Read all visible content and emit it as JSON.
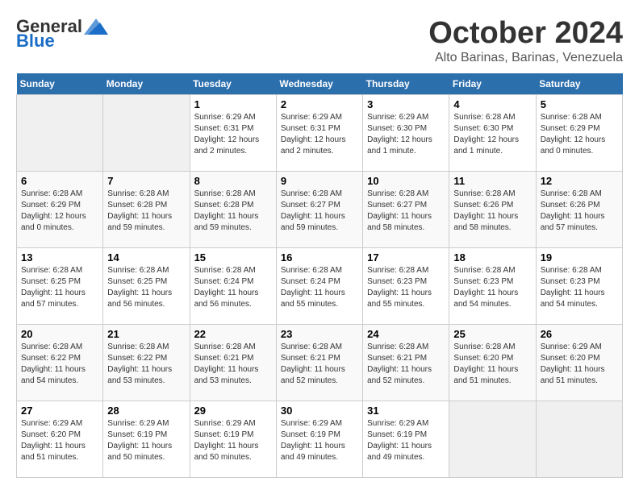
{
  "header": {
    "logo_general": "General",
    "logo_blue": "Blue",
    "month": "October 2024",
    "location": "Alto Barinas, Barinas, Venezuela"
  },
  "weekdays": [
    "Sunday",
    "Monday",
    "Tuesday",
    "Wednesday",
    "Thursday",
    "Friday",
    "Saturday"
  ],
  "weeks": [
    [
      {
        "day": "",
        "info": ""
      },
      {
        "day": "",
        "info": ""
      },
      {
        "day": "1",
        "info": "Sunrise: 6:29 AM\nSunset: 6:31 PM\nDaylight: 12 hours\nand 2 minutes."
      },
      {
        "day": "2",
        "info": "Sunrise: 6:29 AM\nSunset: 6:31 PM\nDaylight: 12 hours\nand 2 minutes."
      },
      {
        "day": "3",
        "info": "Sunrise: 6:29 AM\nSunset: 6:30 PM\nDaylight: 12 hours\nand 1 minute."
      },
      {
        "day": "4",
        "info": "Sunrise: 6:28 AM\nSunset: 6:30 PM\nDaylight: 12 hours\nand 1 minute."
      },
      {
        "day": "5",
        "info": "Sunrise: 6:28 AM\nSunset: 6:29 PM\nDaylight: 12 hours\nand 0 minutes."
      }
    ],
    [
      {
        "day": "6",
        "info": "Sunrise: 6:28 AM\nSunset: 6:29 PM\nDaylight: 12 hours\nand 0 minutes."
      },
      {
        "day": "7",
        "info": "Sunrise: 6:28 AM\nSunset: 6:28 PM\nDaylight: 11 hours\nand 59 minutes."
      },
      {
        "day": "8",
        "info": "Sunrise: 6:28 AM\nSunset: 6:28 PM\nDaylight: 11 hours\nand 59 minutes."
      },
      {
        "day": "9",
        "info": "Sunrise: 6:28 AM\nSunset: 6:27 PM\nDaylight: 11 hours\nand 59 minutes."
      },
      {
        "day": "10",
        "info": "Sunrise: 6:28 AM\nSunset: 6:27 PM\nDaylight: 11 hours\nand 58 minutes."
      },
      {
        "day": "11",
        "info": "Sunrise: 6:28 AM\nSunset: 6:26 PM\nDaylight: 11 hours\nand 58 minutes."
      },
      {
        "day": "12",
        "info": "Sunrise: 6:28 AM\nSunset: 6:26 PM\nDaylight: 11 hours\nand 57 minutes."
      }
    ],
    [
      {
        "day": "13",
        "info": "Sunrise: 6:28 AM\nSunset: 6:25 PM\nDaylight: 11 hours\nand 57 minutes."
      },
      {
        "day": "14",
        "info": "Sunrise: 6:28 AM\nSunset: 6:25 PM\nDaylight: 11 hours\nand 56 minutes."
      },
      {
        "day": "15",
        "info": "Sunrise: 6:28 AM\nSunset: 6:24 PM\nDaylight: 11 hours\nand 56 minutes."
      },
      {
        "day": "16",
        "info": "Sunrise: 6:28 AM\nSunset: 6:24 PM\nDaylight: 11 hours\nand 55 minutes."
      },
      {
        "day": "17",
        "info": "Sunrise: 6:28 AM\nSunset: 6:23 PM\nDaylight: 11 hours\nand 55 minutes."
      },
      {
        "day": "18",
        "info": "Sunrise: 6:28 AM\nSunset: 6:23 PM\nDaylight: 11 hours\nand 54 minutes."
      },
      {
        "day": "19",
        "info": "Sunrise: 6:28 AM\nSunset: 6:23 PM\nDaylight: 11 hours\nand 54 minutes."
      }
    ],
    [
      {
        "day": "20",
        "info": "Sunrise: 6:28 AM\nSunset: 6:22 PM\nDaylight: 11 hours\nand 54 minutes."
      },
      {
        "day": "21",
        "info": "Sunrise: 6:28 AM\nSunset: 6:22 PM\nDaylight: 11 hours\nand 53 minutes."
      },
      {
        "day": "22",
        "info": "Sunrise: 6:28 AM\nSunset: 6:21 PM\nDaylight: 11 hours\nand 53 minutes."
      },
      {
        "day": "23",
        "info": "Sunrise: 6:28 AM\nSunset: 6:21 PM\nDaylight: 11 hours\nand 52 minutes."
      },
      {
        "day": "24",
        "info": "Sunrise: 6:28 AM\nSunset: 6:21 PM\nDaylight: 11 hours\nand 52 minutes."
      },
      {
        "day": "25",
        "info": "Sunrise: 6:28 AM\nSunset: 6:20 PM\nDaylight: 11 hours\nand 51 minutes."
      },
      {
        "day": "26",
        "info": "Sunrise: 6:29 AM\nSunset: 6:20 PM\nDaylight: 11 hours\nand 51 minutes."
      }
    ],
    [
      {
        "day": "27",
        "info": "Sunrise: 6:29 AM\nSunset: 6:20 PM\nDaylight: 11 hours\nand 51 minutes."
      },
      {
        "day": "28",
        "info": "Sunrise: 6:29 AM\nSunset: 6:19 PM\nDaylight: 11 hours\nand 50 minutes."
      },
      {
        "day": "29",
        "info": "Sunrise: 6:29 AM\nSunset: 6:19 PM\nDaylight: 11 hours\nand 50 minutes."
      },
      {
        "day": "30",
        "info": "Sunrise: 6:29 AM\nSunset: 6:19 PM\nDaylight: 11 hours\nand 49 minutes."
      },
      {
        "day": "31",
        "info": "Sunrise: 6:29 AM\nSunset: 6:19 PM\nDaylight: 11 hours\nand 49 minutes."
      },
      {
        "day": "",
        "info": ""
      },
      {
        "day": "",
        "info": ""
      }
    ]
  ]
}
